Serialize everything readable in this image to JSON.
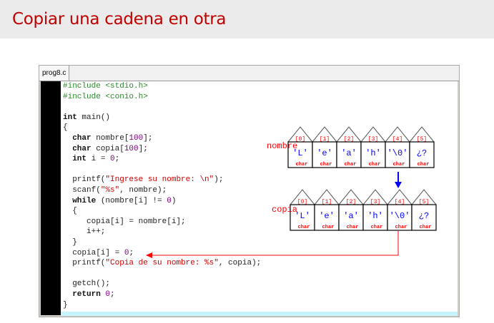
{
  "slide": {
    "title": "Copiar una cadena en otra"
  },
  "editor": {
    "tab": "prog8.c",
    "lines": [
      [
        [
          "pp",
          "#include <stdio.h>"
        ]
      ],
      [
        [
          "pp",
          "#include <conio.h>"
        ]
      ],
      [],
      [
        [
          "kw",
          "int"
        ],
        [
          "t",
          " main()"
        ]
      ],
      [
        [
          "t",
          "{"
        ]
      ],
      [
        [
          "t",
          "  "
        ],
        [
          "kw",
          "char"
        ],
        [
          "t",
          " nombre["
        ],
        [
          "num",
          "100"
        ],
        [
          "t",
          "];"
        ]
      ],
      [
        [
          "t",
          "  "
        ],
        [
          "kw",
          "char"
        ],
        [
          "t",
          " copia["
        ],
        [
          "num",
          "100"
        ],
        [
          "t",
          "];"
        ]
      ],
      [
        [
          "t",
          "  "
        ],
        [
          "kw",
          "int"
        ],
        [
          "t",
          " i = "
        ],
        [
          "num",
          "0"
        ],
        [
          "t",
          ";"
        ]
      ],
      [],
      [
        [
          "t",
          "  printf("
        ],
        [
          "str",
          "\"Ingrese su nombre: \\n\""
        ],
        [
          "t",
          ");"
        ]
      ],
      [
        [
          "t",
          "  scanf("
        ],
        [
          "str",
          "\"%s\""
        ],
        [
          "t",
          ", nombre);"
        ]
      ],
      [
        [
          "t",
          "  "
        ],
        [
          "kw",
          "while"
        ],
        [
          "t",
          " (nombre[i] != "
        ],
        [
          "num",
          "0"
        ],
        [
          "t",
          ")"
        ]
      ],
      [
        [
          "t",
          "  {"
        ]
      ],
      [
        [
          "t",
          "     copia[i] = nombre[i];"
        ]
      ],
      [
        [
          "t",
          "     i++;"
        ]
      ],
      [
        [
          "t",
          "  }"
        ]
      ],
      [
        [
          "t",
          "  copia[i] = "
        ],
        [
          "num",
          "0"
        ],
        [
          "t",
          ";"
        ]
      ],
      [
        [
          "t",
          "  printf("
        ],
        [
          "str",
          "\"Copia de su nombre: %s\""
        ],
        [
          "t",
          ", copia);"
        ]
      ],
      [],
      [
        [
          "t",
          "  getch();"
        ]
      ],
      [
        [
          "t",
          "  "
        ],
        [
          "kw",
          "return"
        ],
        [
          "t",
          " "
        ],
        [
          "num",
          "0"
        ],
        [
          "t",
          ";"
        ]
      ],
      [
        [
          "t",
          "}"
        ]
      ]
    ]
  },
  "diagram": {
    "arrays": [
      {
        "name": "nombre",
        "indices": [
          "[0]",
          "[1]",
          "[2]",
          "[3]",
          "[4]",
          "[5]"
        ],
        "values": [
          "'L'",
          "'e'",
          "'a'",
          "'h'",
          "'\\0'",
          "¿?"
        ],
        "type": "char"
      },
      {
        "name": "copia",
        "indices": [
          "[0]",
          "[1]",
          "[2]",
          "[3]",
          "[4]",
          "[5]"
        ],
        "values": [
          "'L'",
          "'e'",
          "'a'",
          "'h'",
          "'\\0'",
          "¿?"
        ],
        "type": "char"
      }
    ],
    "colors": {
      "label": "#ff0000",
      "value": "#0000ff",
      "arrow_blue": "#0000ff",
      "arrow_red": "#ff0000"
    }
  }
}
